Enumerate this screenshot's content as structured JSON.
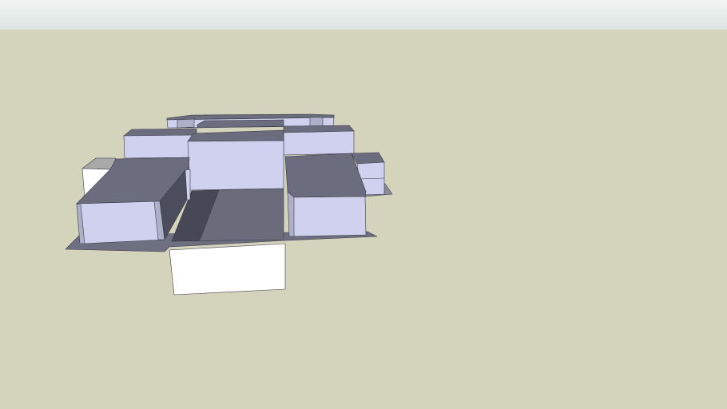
{
  "scene": {
    "colors": {
      "sky": "#e6ecea",
      "ground": "#d4d3bc",
      "roof": "#6b6c7e",
      "wall": "#cfd1ee",
      "wall_shadow": "#aeb0c8",
      "base": "#6e6f80",
      "white_box": "#ffffff"
    }
  }
}
